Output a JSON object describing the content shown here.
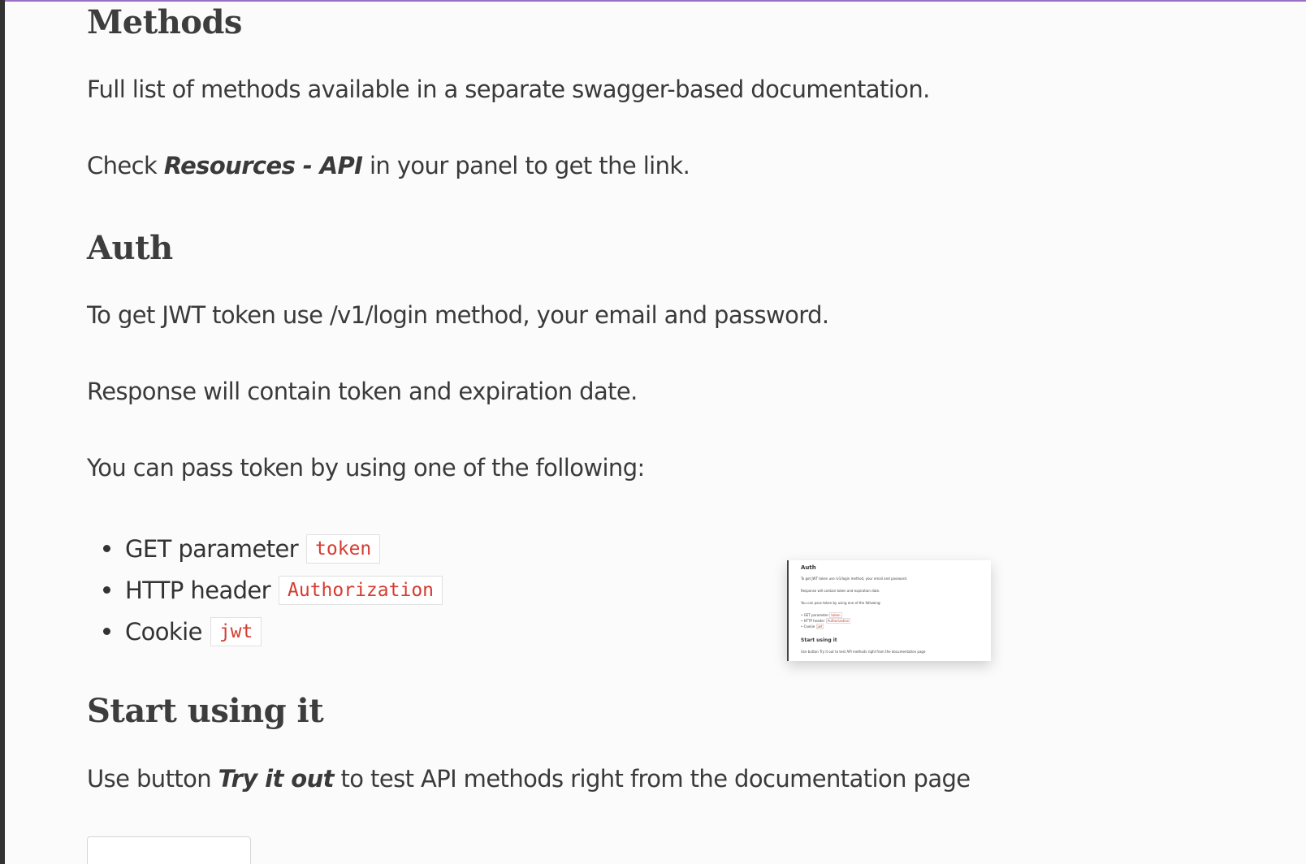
{
  "methods": {
    "heading": "Methods",
    "line1": "Full list of methods available in a separate swagger-based documentation.",
    "line2_prefix": "Check ",
    "line2_emph": "Resources - API",
    "line2_suffix": " in your panel to get the link."
  },
  "auth": {
    "heading": "Auth",
    "line1": "To get JWT token use /v1/login method, your email and password.",
    "line2": "Response will contain token and expiration date.",
    "line3": "You can pass token by using one of the following:",
    "options": [
      {
        "label": "GET parameter",
        "code": "token"
      },
      {
        "label": "HTTP header",
        "code": "Authorization"
      },
      {
        "label": "Cookie",
        "code": "jwt"
      }
    ]
  },
  "start": {
    "heading": "Start using it",
    "line_prefix": "Use button ",
    "line_emph": "Try it out",
    "line_suffix": " to test API methods right from the documentation page"
  },
  "thumbnail": {
    "title": "Auth",
    "lines": [
      "To get JWT token use /v1/login method, your email and password.",
      "Response will contain token and expiration date.",
      "You can pass token by using one of the following:"
    ],
    "options": [
      {
        "label": "GET parameter",
        "code": "token"
      },
      {
        "label": "HTTP header",
        "code": "Authorization"
      },
      {
        "label": "Cookie",
        "code": "jwt"
      }
    ],
    "heading2": "Start using it",
    "footer": "Use button Try it out to test API methods right from the documentation page"
  },
  "colors": {
    "accent": "#9b6fc4",
    "code_text": "#d63b2f",
    "left_bar": "#333333"
  }
}
